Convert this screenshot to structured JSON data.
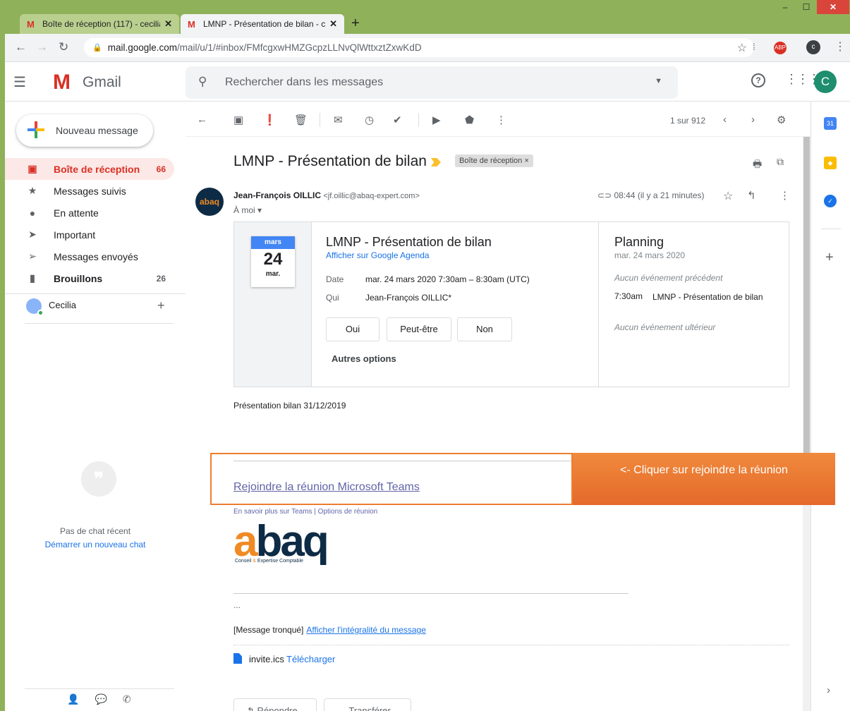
{
  "browser": {
    "tabs": [
      {
        "title": "Boîte de réception (117) - cecilia"
      },
      {
        "title": "LMNP - Présentation de bilan - c"
      }
    ],
    "new_tab": "+",
    "url_host": "mail.google.com",
    "url_path": "/mail/u/1/#inbox/FMfcgxwHMZGcpzLLNvQlWttxztZxwKdD",
    "ext_profile": "c"
  },
  "gmail": {
    "app_name": "Gmail",
    "search_placeholder": "Rechercher dans les messages",
    "account_initial": "C",
    "compose_label": "Nouveau message",
    "nav": [
      {
        "label": "Boîte de réception",
        "count": "66",
        "icon": "inbox-icon"
      },
      {
        "label": "Messages suivis",
        "count": "",
        "icon": "star-icon"
      },
      {
        "label": "En attente",
        "count": "",
        "icon": "clock-icon"
      },
      {
        "label": "Important",
        "count": "",
        "icon": "important-icon"
      },
      {
        "label": "Messages envoyés",
        "count": "",
        "icon": "send-icon"
      },
      {
        "label": "Brouillons",
        "count": "26",
        "icon": "draft-icon"
      }
    ],
    "hangouts_user": "Cecilia",
    "chat_empty": "Pas de chat récent",
    "chat_start": "Démarrer un nouveau chat"
  },
  "message": {
    "pager": "1 sur 912",
    "subject": "LMNP - Présentation de bilan",
    "label": "Boîte de réception",
    "sender_name": "Jean-François OILLIC",
    "sender_email": "<jf.oillic@abaq-expert.com>",
    "to": "À moi",
    "time": "08:44 (il y a 21 minutes)",
    "avatar_text": "abaq",
    "calendar": {
      "month": "mars",
      "day": "24",
      "dow": "mar.",
      "title": "LMNP - Présentation de bilan",
      "link": "Afficher sur Google Agenda",
      "date_key": "Date",
      "date_val": "mar. 24 mars 2020 7:30am – 8:30am (UTC)",
      "who_key": "Qui",
      "who_val": "Jean-François OILLIC*",
      "yes": "Oui",
      "maybe": "Peut-être",
      "no": "Non",
      "more": "Autres options",
      "planning_title": "Planning",
      "planning_date": "mar. 24 mars 2020",
      "prev": "Aucun événement précédent",
      "event_time": "7:30am",
      "event_title": "LMNP - Présentation de bilan",
      "next": "Aucun événement ultérieur"
    },
    "body": "Présentation bilan 31/12/2019",
    "teams_link": "Rejoindre la réunion Microsoft Teams",
    "teams_links": "En savoir plus sur Teams | Options de réunion",
    "logo_a": "a",
    "logo_rest": "baq",
    "logo_tag_1": "Conseil ",
    "logo_tag_amp": "&",
    "logo_tag_2": " Expertise Comptable",
    "ellipsis": "...",
    "truncated": "[Message tronqué]",
    "truncated_link": "Afficher l'intégralité du message",
    "attachment": "invite.ics",
    "download": "Télécharger",
    "reply": "Répondre",
    "forward": "Transférer"
  },
  "annotation": {
    "callout": "<- Cliquer sur rejoindre la réunion"
  },
  "colors": {
    "accent": "#d93025",
    "annotation": "#ed7d31",
    "link": "#1a73e8",
    "teams": "#6264a7"
  }
}
